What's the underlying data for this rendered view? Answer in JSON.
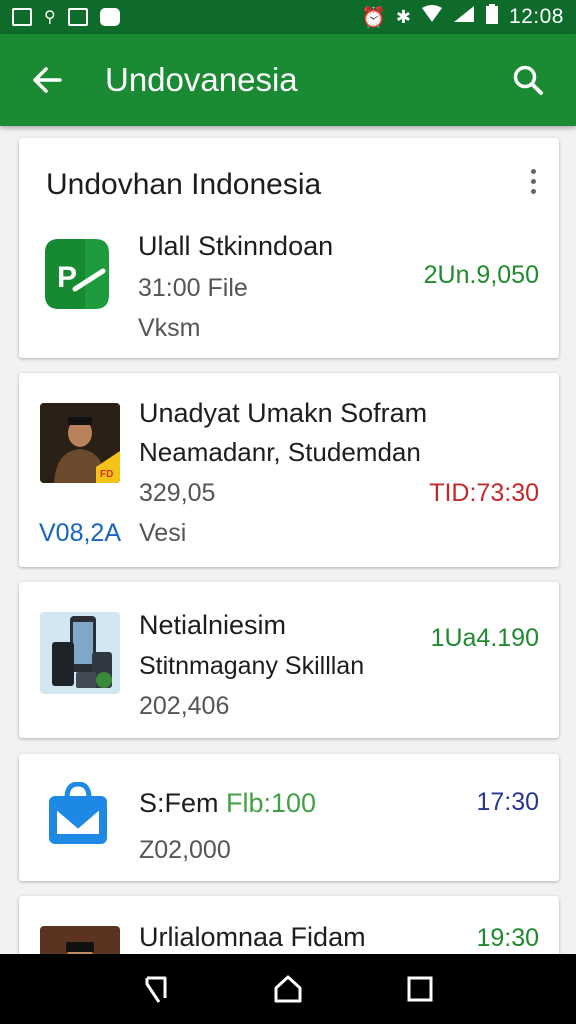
{
  "status_bar": {
    "time": "12:08"
  },
  "app_bar": {
    "title": "Undovanesia"
  },
  "section": {
    "title": "Undovhan Indonesia"
  },
  "items": [
    {
      "title": "Ulall Stkinndoan",
      "subtitle": "31:00 File",
      "meta": "Vksm",
      "value": "2Un.9,050",
      "value_color": "#1f8a2e",
      "icon": "document-app-icon"
    },
    {
      "title": "Unadyat Umakn Sofram",
      "subtitle": "Neamadanr, Studemdan",
      "meta": "329,05",
      "value": "TID:73:30",
      "value_color": "#c62828",
      "tag": "V08,2A",
      "tag2": "Vesi",
      "icon": "person-photo-thumbnail",
      "badge": "FD"
    },
    {
      "title": "Netialniesim",
      "subtitle": "Stitnmagany Skilllan",
      "meta": "202,406",
      "value": "1Ua4.190",
      "value_color": "#1f8a2e",
      "icon": "phones-thumbnail"
    },
    {
      "title_prefix": "S:Fem ",
      "title_highlight": "Flb:100",
      "meta": "Z02,000",
      "value": "17:30",
      "value_color": "#283593",
      "icon": "mail-bag-icon"
    },
    {
      "title": "Urlialomnaa Fidam",
      "value": "19:30",
      "value_color": "#1f8a2e",
      "icon": "person-photo-thumbnail"
    }
  ],
  "colors": {
    "status_bar": "#0f6b2a",
    "app_bar": "#1a8a33",
    "green_text": "#1f8a2e",
    "red_text": "#c62828",
    "blue_tag": "#1565c0"
  }
}
